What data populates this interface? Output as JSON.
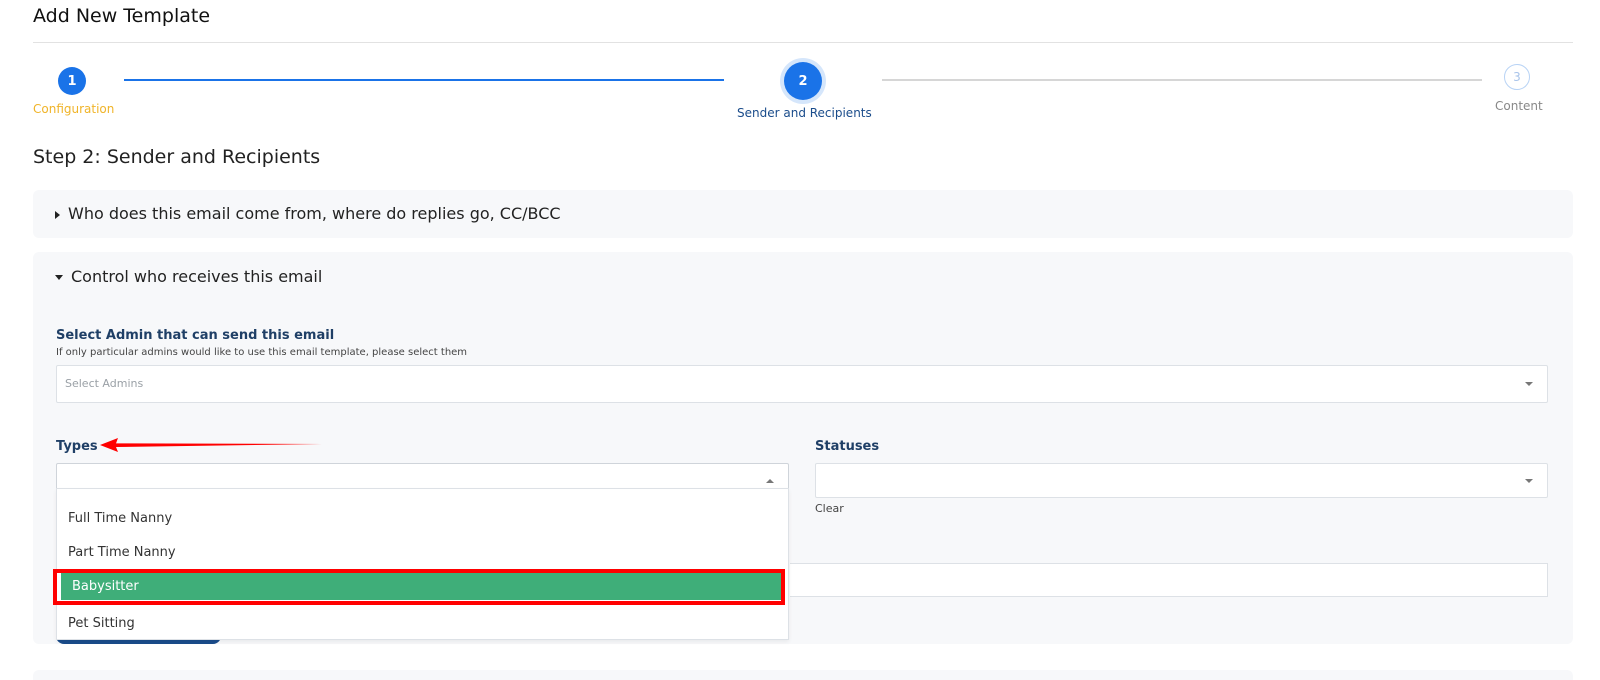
{
  "page": {
    "title": "Add New Template"
  },
  "stepper": {
    "steps": [
      {
        "number": "1",
        "label": "Configuration",
        "state": "complete"
      },
      {
        "number": "2",
        "label": "Sender and Recipients",
        "state": "active"
      },
      {
        "number": "3",
        "label": "Content",
        "state": "pending"
      }
    ]
  },
  "step_heading": "Step 2: Sender and Recipients",
  "panels": {
    "sender": {
      "title": "Who does this email come from, where do replies go, CC/BCC",
      "expanded": false
    },
    "recipients": {
      "title": "Control who receives this email",
      "expanded": true
    }
  },
  "admins": {
    "label": "Select Admin that can send this email",
    "help": "If only particular admins would like to use this email template, please select them",
    "placeholder": "Select Admins"
  },
  "types": {
    "label": "Types",
    "options": [
      "Full Time Nanny",
      "Part Time Nanny",
      "Babysitter",
      "Pet Sitting"
    ],
    "highlighted": "Babysitter"
  },
  "statuses": {
    "label": "Statuses",
    "clear": "Clear"
  },
  "colors": {
    "primary": "#1a73e8",
    "label_orange": "#f0b429",
    "selected_green": "#3fae79",
    "annotation_red": "#ff0000",
    "field_label": "#1f3f66"
  },
  "icons": {
    "collapsed": "caret-right-icon",
    "expanded": "caret-down-icon",
    "select": "chevron-down-icon",
    "select_open": "chevron-up-icon",
    "annotation": "red-arrow-icon"
  }
}
